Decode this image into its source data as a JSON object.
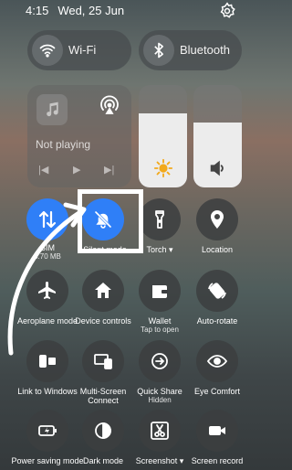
{
  "status": {
    "time": "4:15",
    "date": "Wed, 25 Jun"
  },
  "pills": {
    "wifi": "Wi-Fi",
    "bluetooth": "Bluetooth"
  },
  "media": {
    "status": "Not playing"
  },
  "sliders": {
    "brightness": 0.72,
    "volume": 0.63
  },
  "tiles": {
    "sim": {
      "label": "SIM",
      "sub": "8.70 MB"
    },
    "silent": {
      "label": "Silent mode"
    },
    "torch": {
      "label": "Torch ▾"
    },
    "location": {
      "label": "Location"
    },
    "aeroplane": {
      "label": "Aeroplane mode"
    },
    "device": {
      "label": "Device controls"
    },
    "wallet": {
      "label": "Wallet",
      "sub": "Tap to open"
    },
    "autorotate": {
      "label": "Auto-rotate"
    },
    "link": {
      "label": "Link to Windows"
    },
    "multiscreen": {
      "label": "Multi-Screen Connect"
    },
    "quickshare": {
      "label": "Quick Share",
      "sub": "Hidden"
    },
    "eyecomfort": {
      "label": "Eye Comfort"
    },
    "powersaving": {
      "label": "Power saving mode"
    },
    "darkmode": {
      "label": "Dark mode"
    },
    "screenshot": {
      "label": "Screenshot ▾"
    },
    "screenrecord": {
      "label": "Screen record"
    }
  },
  "colors": {
    "active": "#2f7ff7",
    "annotation": "#ffffff"
  },
  "icons": [
    "wifi-icon",
    "bluetooth-icon",
    "music-note-icon",
    "cast-icon",
    "sun-icon",
    "speaker-icon",
    "data-arrows-icon",
    "bell-off-icon",
    "flashlight-icon",
    "location-pin-icon",
    "airplane-icon",
    "home-icon",
    "wallet-icon",
    "rotate-icon",
    "link-windows-icon",
    "multi-screen-icon",
    "quick-share-icon",
    "eye-icon",
    "battery-icon",
    "half-moon-icon",
    "scissors-icon",
    "video-camera-icon",
    "settings-gear-icon"
  ]
}
